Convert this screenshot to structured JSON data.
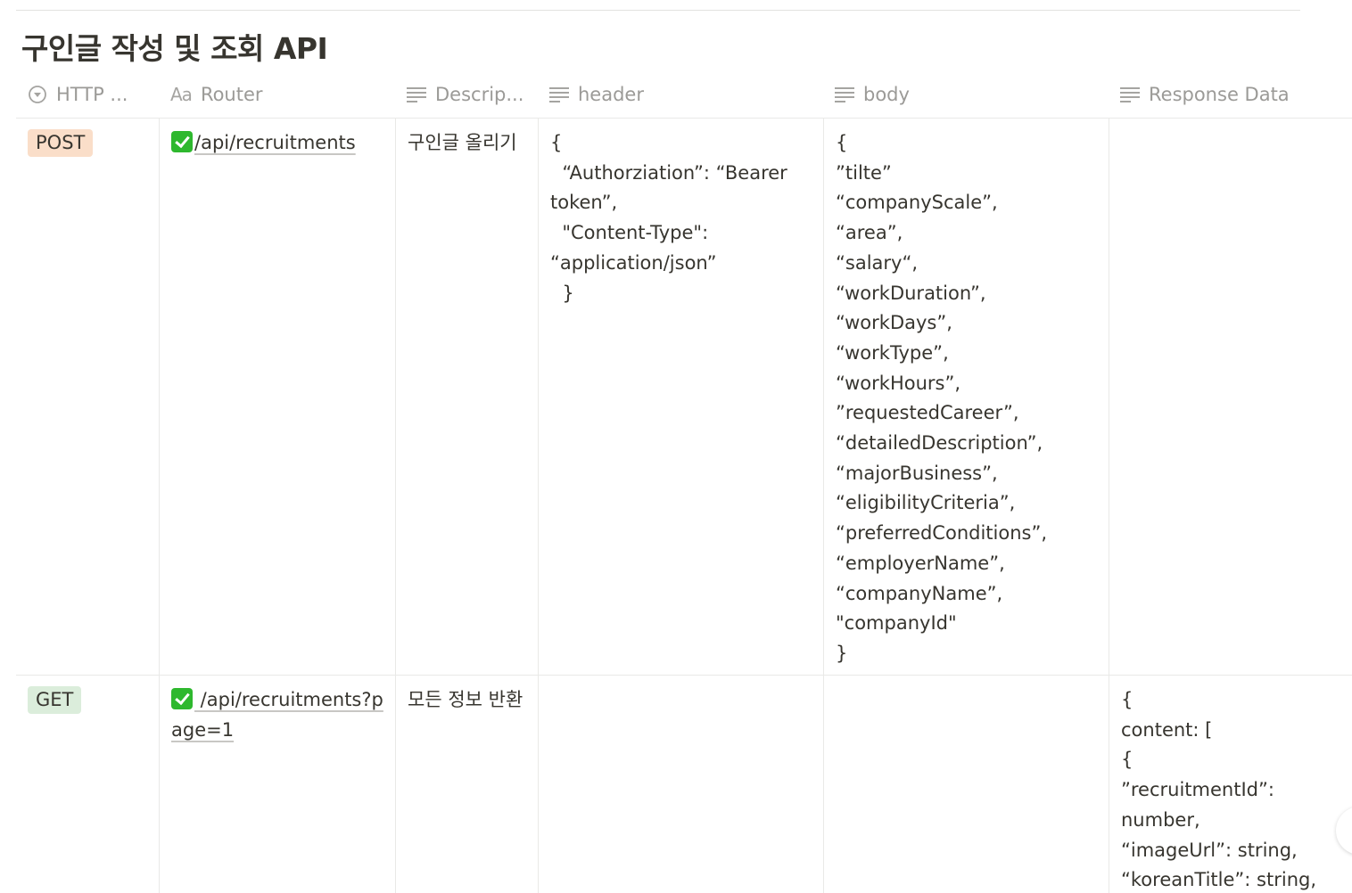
{
  "page": {
    "title": "구인글 작성 및 조회 API"
  },
  "columns": [
    {
      "label": "HTTP ...",
      "icon": "select-icon"
    },
    {
      "label": "Router",
      "icon": "title-aa-icon",
      "icon_text": "Aa"
    },
    {
      "label": "Descrip...",
      "icon": "text-lines-icon"
    },
    {
      "label": "header",
      "icon": "text-lines-icon"
    },
    {
      "label": "body",
      "icon": "text-lines-icon"
    },
    {
      "label": "Response Data",
      "icon": "text-lines-icon"
    }
  ],
  "rows": [
    {
      "method": "POST",
      "method_color": "#fadec9",
      "router": "/api/recruitments",
      "description": "구인글 올리기",
      "header": [
        "{",
        "  “Authorziation”: “Bearer token”,",
        "  \"Content-Type\": “application/json”",
        "  }"
      ],
      "body": [
        "{",
        "”tilte”",
        "“companyScale”,",
        "“area”,",
        "“salary“,",
        "“workDuration”,",
        "“workDays”,",
        "“workType”,",
        "“workHours”,",
        "”requestedCareer”,",
        "“detailedDescription”,",
        "“majorBusiness”,",
        "“eligibilityCriteria”,",
        "“preferredConditions”,",
        "“employerName”,",
        "“companyName”,",
        "\"companyId\"",
        "}"
      ],
      "response": []
    },
    {
      "method": "GET",
      "method_color": "#dbeddb",
      "router": " /api/recruitments?page=1",
      "description": "모든 정보 반환",
      "header": [],
      "body": [],
      "response": [
        "{",
        "content: [",
        "{",
        "”recruitmentId”: number,",
        "“imageUrl”: string,",
        "“koreanTitle”: string,"
      ]
    }
  ]
}
